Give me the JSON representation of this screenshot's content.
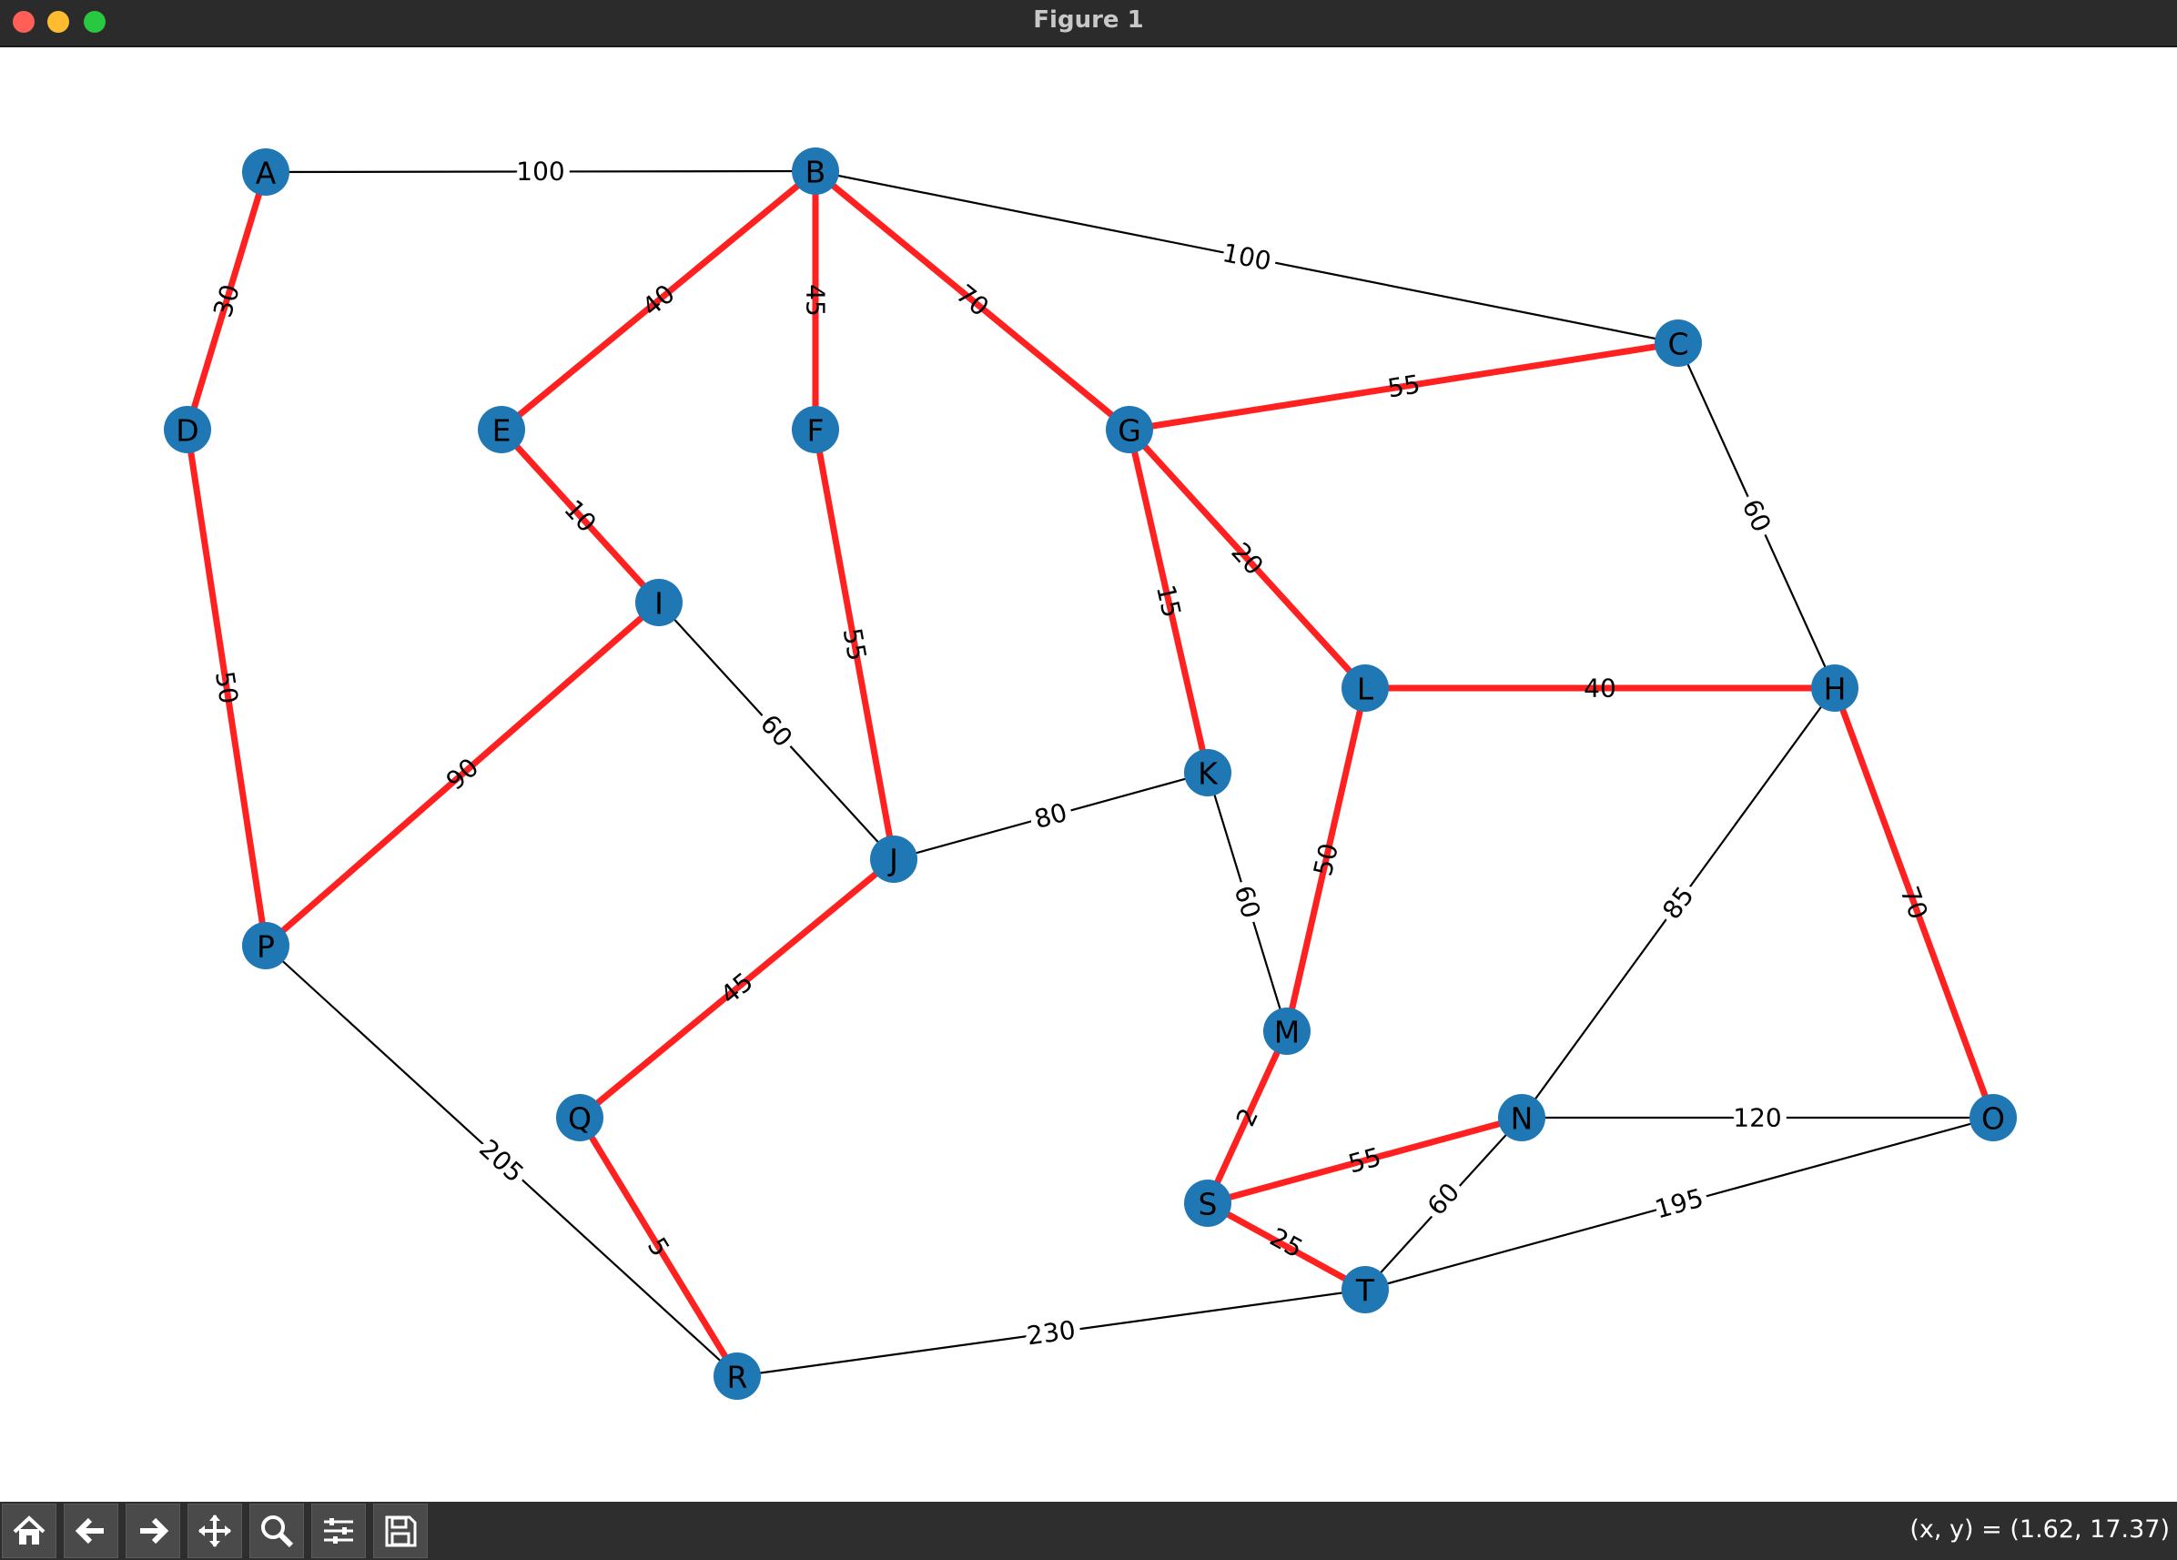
{
  "window": {
    "title": "Figure 1",
    "traffic_lights": [
      {
        "name": "close",
        "color": "#ff5f57"
      },
      {
        "name": "minimize",
        "color": "#febc2e"
      },
      {
        "name": "zoom",
        "color": "#28c840"
      }
    ]
  },
  "graph": {
    "node_color": "#1f77b4",
    "highlight_color": "#ff2020",
    "edge_color": "#000000",
    "nodes": [
      "A",
      "B",
      "C",
      "D",
      "E",
      "F",
      "G",
      "H",
      "I",
      "J",
      "K",
      "L",
      "M",
      "N",
      "O",
      "P",
      "Q",
      "R",
      "S",
      "T"
    ],
    "edges": [
      {
        "u": "A",
        "v": "B",
        "w": "100",
        "highlighted": false
      },
      {
        "u": "B",
        "v": "C",
        "w": "100",
        "highlighted": false
      },
      {
        "u": "C",
        "v": "H",
        "w": "60",
        "highlighted": false
      },
      {
        "u": "I",
        "v": "J",
        "w": "60",
        "highlighted": false
      },
      {
        "u": "J",
        "v": "K",
        "w": "80",
        "highlighted": false
      },
      {
        "u": "K",
        "v": "M",
        "w": "60",
        "highlighted": false
      },
      {
        "u": "H",
        "v": "N",
        "w": "85",
        "highlighted": false
      },
      {
        "u": "N",
        "v": "O",
        "w": "120",
        "highlighted": false
      },
      {
        "u": "N",
        "v": "T",
        "w": "60",
        "highlighted": false
      },
      {
        "u": "T",
        "v": "O",
        "w": "195",
        "highlighted": false
      },
      {
        "u": "P",
        "v": "R",
        "w": "205",
        "highlighted": false
      },
      {
        "u": "R",
        "v": "T",
        "w": "230",
        "highlighted": false
      },
      {
        "u": "A",
        "v": "D",
        "w": "30",
        "highlighted": true
      },
      {
        "u": "D",
        "v": "P",
        "w": "50",
        "highlighted": true
      },
      {
        "u": "B",
        "v": "E",
        "w": "40",
        "highlighted": true
      },
      {
        "u": "B",
        "v": "F",
        "w": "45",
        "highlighted": true
      },
      {
        "u": "B",
        "v": "G",
        "w": "70",
        "highlighted": true
      },
      {
        "u": "G",
        "v": "C",
        "w": "55",
        "highlighted": true
      },
      {
        "u": "E",
        "v": "I",
        "w": "10",
        "highlighted": true
      },
      {
        "u": "F",
        "v": "J",
        "w": "55",
        "highlighted": true
      },
      {
        "u": "G",
        "v": "K",
        "w": "15",
        "highlighted": true
      },
      {
        "u": "G",
        "v": "L",
        "w": "20",
        "highlighted": true
      },
      {
        "u": "L",
        "v": "H",
        "w": "40",
        "highlighted": true
      },
      {
        "u": "H",
        "v": "O",
        "w": "70",
        "highlighted": true
      },
      {
        "u": "I",
        "v": "P",
        "w": "90",
        "highlighted": true
      },
      {
        "u": "J",
        "v": "Q",
        "w": "45",
        "highlighted": true
      },
      {
        "u": "L",
        "v": "M",
        "w": "50",
        "highlighted": true
      },
      {
        "u": "M",
        "v": "S",
        "w": "2",
        "highlighted": true
      },
      {
        "u": "S",
        "v": "N",
        "w": "55",
        "highlighted": true
      },
      {
        "u": "S",
        "v": "T",
        "w": "25",
        "highlighted": true
      },
      {
        "u": "Q",
        "v": "R",
        "w": "5",
        "highlighted": true
      }
    ]
  },
  "toolbar": {
    "buttons": [
      "home-icon",
      "back-icon",
      "forward-icon",
      "pan-icon",
      "zoom-icon",
      "configure-icon",
      "save-icon"
    ],
    "coords": "(x, y) = (1.62, 17.37)"
  }
}
